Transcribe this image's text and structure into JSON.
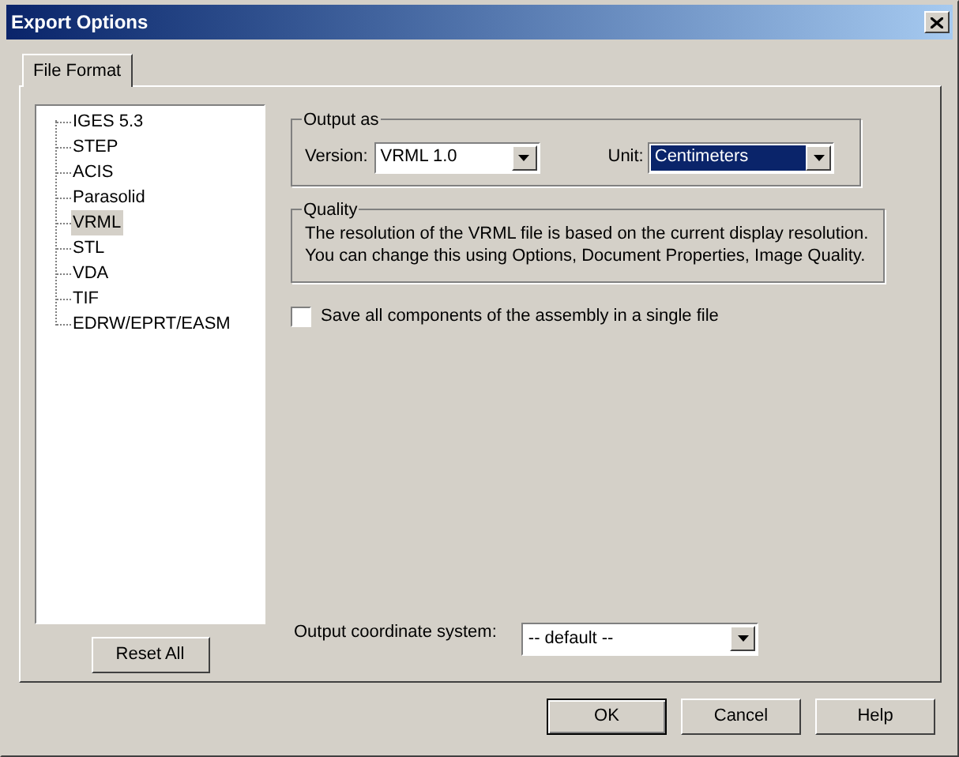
{
  "window": {
    "title": "Export Options"
  },
  "tabs": [
    {
      "label": "File Format",
      "selected": true
    }
  ],
  "formats": [
    {
      "label": "IGES 5.3",
      "selected": false
    },
    {
      "label": "STEP",
      "selected": false
    },
    {
      "label": "ACIS",
      "selected": false
    },
    {
      "label": "Parasolid",
      "selected": false
    },
    {
      "label": "VRML",
      "selected": true
    },
    {
      "label": "STL",
      "selected": false
    },
    {
      "label": "VDA",
      "selected": false
    },
    {
      "label": "TIF",
      "selected": false
    },
    {
      "label": "EDRW/EPRT/EASM",
      "selected": false
    }
  ],
  "reset_button": "Reset All",
  "output_as": {
    "title": "Output as",
    "version_label": "Version:",
    "version": {
      "value": "VRML 1.0",
      "focused": false
    },
    "unit_label": "Unit:",
    "unit": {
      "value": "Centimeters",
      "focused": true
    }
  },
  "quality": {
    "title": "Quality",
    "text": "The resolution of the VRML file is based on the current display resolution.\nYou can change this using Options, Document Properties, Image Quality."
  },
  "save_single_file": {
    "label": "Save all components of the assembly in a single file",
    "checked": false
  },
  "coordinate_system": {
    "label": "Output coordinate system:",
    "value": "-- default --"
  },
  "buttons": [
    {
      "label": "OK",
      "default": true
    },
    {
      "label": "Cancel",
      "default": false
    },
    {
      "label": "Help",
      "default": false
    }
  ]
}
